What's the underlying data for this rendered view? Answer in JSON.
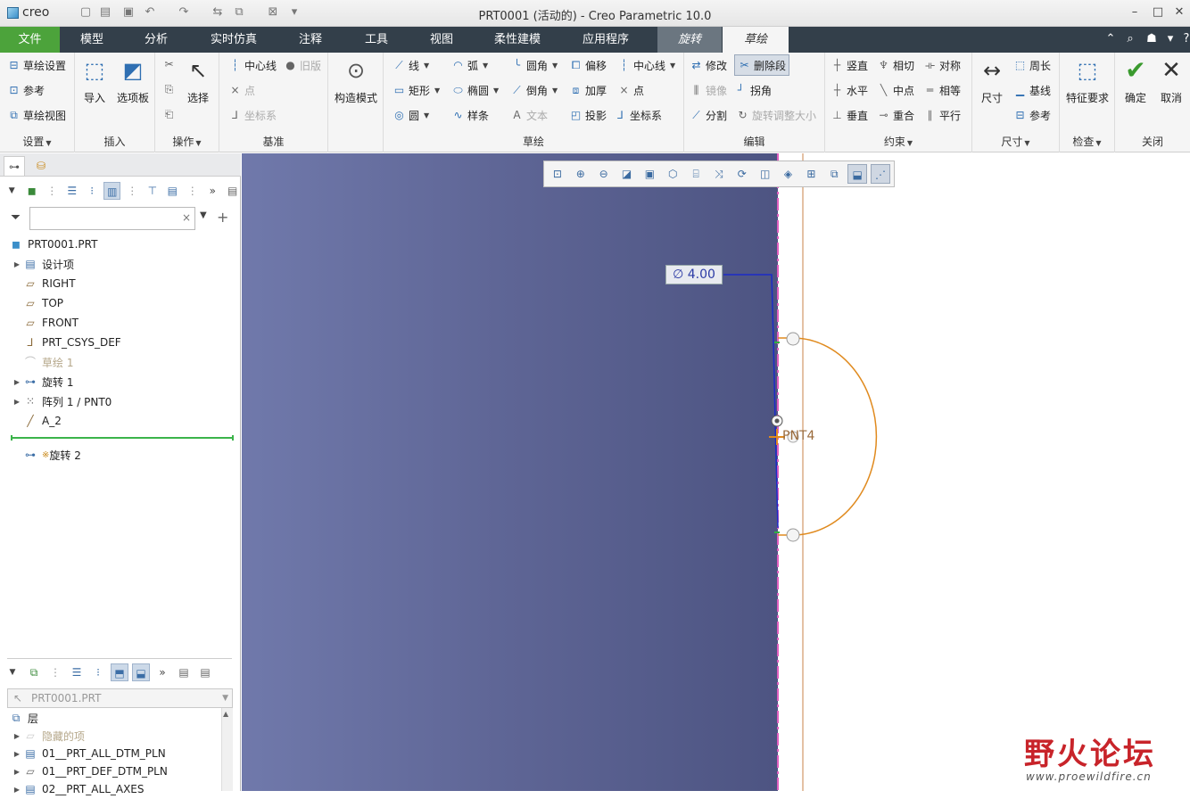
{
  "app": {
    "logo": "creo",
    "window_title": "PRT0001 (活动的) - Creo Parametric 10.0"
  },
  "tabs": {
    "file": "文件",
    "model": "模型",
    "analysis": "分析",
    "simulate": "实时仿真",
    "annotate": "注释",
    "tools": "工具",
    "view": "视图",
    "flexible": "柔性建模",
    "apps": "应用程序",
    "revolve": "旋转",
    "sketch": "草绘"
  },
  "ribbon": {
    "setup": {
      "sketch_setup": "草绘设置",
      "references": "参考",
      "sketch_view": "草绘视图",
      "group": "设置"
    },
    "insert": {
      "import": "导入",
      "palette": "选项板",
      "group": "插入"
    },
    "operations": {
      "select": "选择",
      "group": "操作"
    },
    "datum": {
      "centerline": "中心线",
      "legacy": "旧版",
      "point": "点",
      "csys": "坐标系",
      "group": "基准"
    },
    "construction": {
      "label": "构造模式"
    },
    "sketching": {
      "line": "线",
      "arc": "弧",
      "fillet": "圆角",
      "offset": "偏移",
      "centerline": "中心线",
      "rectangle": "矩形",
      "ellipse": "椭圆",
      "chamfer": "倒角",
      "thicken": "加厚",
      "point": "点",
      "circle": "圆",
      "spline": "样条",
      "text": "文本",
      "project": "投影",
      "csys": "坐标系",
      "group": "草绘"
    },
    "editing": {
      "modify": "修改",
      "delete_segment": "删除段",
      "mirror": "镜像",
      "corner": "拐角",
      "divide": "分割",
      "rotate_resize": "旋转调整大小",
      "group": "编辑"
    },
    "constrain": {
      "vertical": "竖直",
      "tangent": "相切",
      "symmetric": "对称",
      "horizontal": "水平",
      "midpoint": "中点",
      "equal": "相等",
      "perpendicular": "垂直",
      "coincident": "重合",
      "parallel": "平行",
      "group": "约束"
    },
    "dimension": {
      "dimension": "尺寸",
      "perimeter": "周长",
      "baseline": "基线",
      "reference": "参考",
      "group": "尺寸"
    },
    "inspect": {
      "feature_req": "特征要求",
      "group": "检查"
    },
    "close": {
      "ok": "确定",
      "cancel": "取消",
      "group": "关闭"
    }
  },
  "model_tree": {
    "root": "PRT0001.PRT",
    "items": [
      "设计项",
      "RIGHT",
      "TOP",
      "FRONT",
      "PRT_CSYS_DEF",
      "草绘 1",
      "旋转 1",
      "阵列 1 / PNT0",
      "A_2",
      "旋转 2"
    ],
    "new_marker": "※"
  },
  "layers": {
    "selector": "PRT0001.PRT",
    "root": "层",
    "items": [
      "隐藏的项",
      "01__PRT_ALL_DTM_PLN",
      "01__PRT_DEF_DTM_PLN",
      "02__PRT_ALL_AXES"
    ]
  },
  "canvas": {
    "diameter_dim": "∅ 4.00",
    "point_label": "PNT4"
  },
  "watermark": {
    "text": "野火论坛",
    "url": "www.proewildfire.cn"
  },
  "colors": {
    "file_tab": "#4ca33b",
    "tabbar": "#333f4a",
    "sketch_arc": "#e08a1e",
    "dimension": "#2b3aa5",
    "insert_bar": "#3bb34a",
    "viewport_bg": "#5e6595"
  }
}
